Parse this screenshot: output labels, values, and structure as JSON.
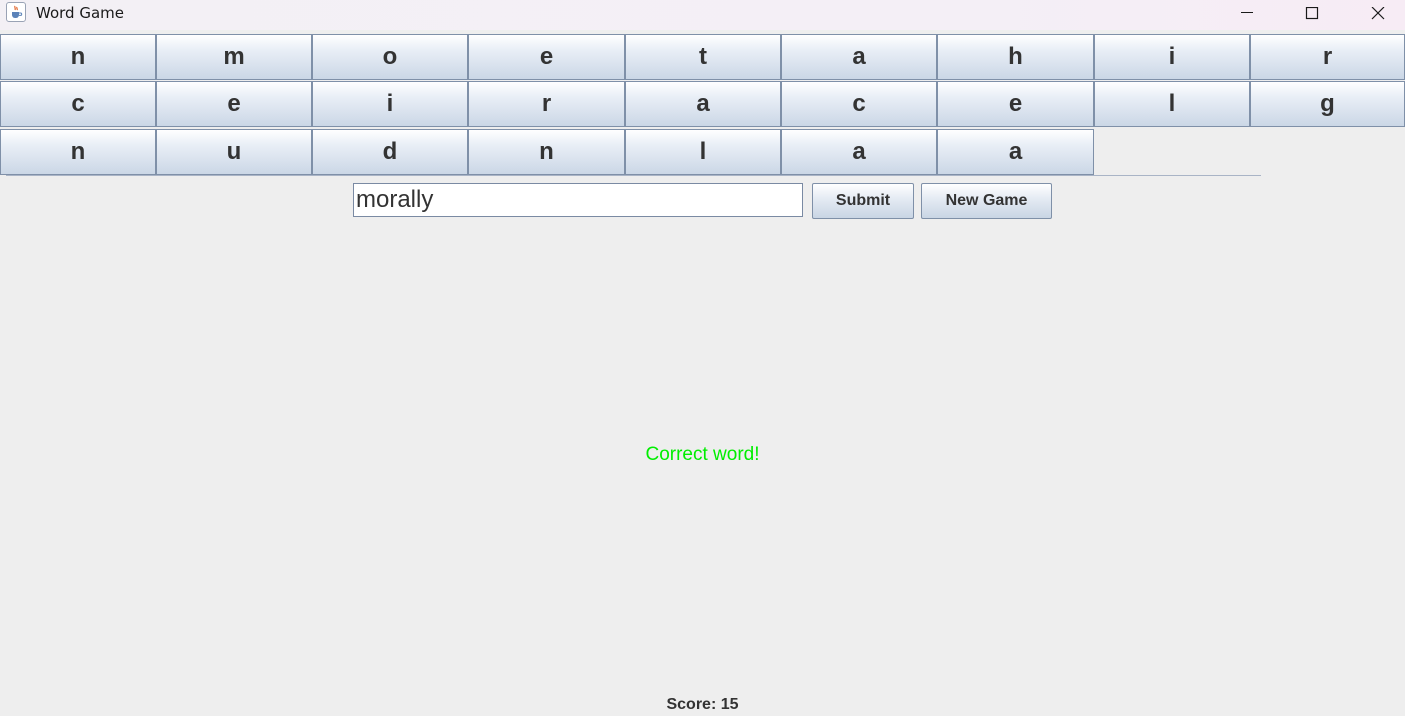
{
  "window": {
    "title": "Word Game"
  },
  "grid": {
    "rows": [
      [
        "n",
        "m",
        "o",
        "e",
        "t",
        "a",
        "h",
        "i",
        "r"
      ],
      [
        "c",
        "e",
        "i",
        "r",
        "a",
        "c",
        "e",
        "l",
        "g"
      ],
      [
        "n",
        "u",
        "d",
        "n",
        "l",
        "a",
        "a"
      ]
    ]
  },
  "input": {
    "value": "morally"
  },
  "buttons": {
    "submit_label": "Submit",
    "new_game_label": "New Game"
  },
  "status": {
    "message": "Correct word!",
    "color": "#00ee00"
  },
  "score": {
    "label": "Score: 15"
  },
  "icons": {
    "app": "java-cup-icon",
    "minimize": "minimize-icon",
    "maximize": "maximize-icon",
    "close": "close-icon"
  }
}
